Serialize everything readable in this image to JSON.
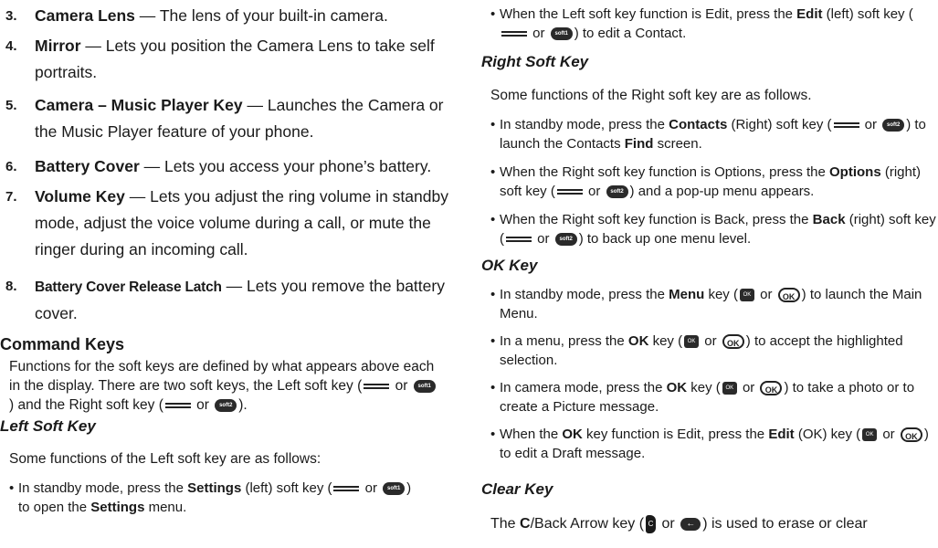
{
  "left": {
    "items": [
      {
        "num": "3.",
        "title": "Camera Lens",
        "sep": " — ",
        "text": "The lens of your built-in camera."
      },
      {
        "num": "4.",
        "title": "Mirror",
        "sep": " — ",
        "text": "Lets you position the Camera Lens to take self portraits."
      },
      {
        "num": "5.",
        "title": "Camera – Music Player Key",
        "sep": " — ",
        "text": "Launches the Camera or the Music Player feature of your phone."
      },
      {
        "num": "6.",
        "title": "Battery Cover",
        "sep": " — ",
        "text": "Lets you access your phone’s battery."
      },
      {
        "num": "7.",
        "title": "Volume Key",
        "sep": " — ",
        "text": "Lets you adjust the ring volume in standby mode, adjust the voice volume during a call, or mute the ringer during an incoming call."
      },
      {
        "num": "8.",
        "title": "Battery Cover Release Latch",
        "sep": " — ",
        "text": "Lets you remove the battery cover."
      }
    ],
    "command_keys": {
      "heading": "Command Keys",
      "p1": "Functions for the soft keys are defined by what appears above each in the display. There are two soft keys, the Left soft key (",
      "or1": " or ",
      "p2": ") and the Right soft key (",
      "or2": " or ",
      "p3": ")."
    },
    "left_soft_key": {
      "heading": "Left Soft Key",
      "intro": "Some functions of the Left soft key are as follows:",
      "b1_a": "In standby mode, press the ",
      "b1_bold": "Settings",
      "b1_b": " (left) soft key (",
      "b1_or": " or ",
      "b1_c": ") to open the ",
      "b1_bold2": "Settings",
      "b1_d": " menu."
    }
  },
  "right": {
    "edit_bullet": {
      "a": "When the Left soft key function is Edit, press the ",
      "bold": "Edit",
      "b": " (left) soft key (",
      "or": " or ",
      "c": ") to edit a Contact."
    },
    "right_soft_key": {
      "heading": "Right Soft Key",
      "intro": "Some functions of the Right soft key are as follows.",
      "b1_a": "In standby mode, press the ",
      "b1_bold": "Contacts",
      "b1_b": " (Right) soft key (",
      "b1_or": " or ",
      "b1_c": ") to launch the Contacts ",
      "b1_bold2": "Find",
      "b1_d": " screen.",
      "b2_a": "When the Right soft key function is Options, press the ",
      "b2_bold": "Options",
      "b2_b": " (right) soft key (",
      "b2_or": " or ",
      "b2_c": ") and a pop-up menu appears.",
      "b3_a": "When the Right soft key function is Back, press the ",
      "b3_bold": "Back",
      "b3_b": " (right) soft key (",
      "b3_or": " or ",
      "b3_c": ") to back up one menu level."
    },
    "ok_key": {
      "heading": "OK Key",
      "b1_a": "In standby mode, press the ",
      "b1_bold": "Menu",
      "b1_b": " key (",
      "b1_or": " or ",
      "b1_c": ") to launch the Main Menu.",
      "b2_a": "In a menu, press the ",
      "b2_bold": "OK",
      "b2_b": " key (",
      "b2_or": " or ",
      "b2_c": ") to accept the highlighted selection.",
      "b3_a": "In camera mode, press the ",
      "b3_bold": "OK",
      "b3_b": " key (",
      "b3_or": " or ",
      "b3_c": ") to take a photo or to create a Picture message.",
      "b4_a": "When the ",
      "b4_bold": "OK",
      "b4_b": " key function is Edit, press the ",
      "b4_bold2": "Edit",
      "b4_c": " (OK) key (",
      "b4_or": " or ",
      "b4_d": ") to edit a Draft message."
    },
    "clear_key": {
      "heading": "Clear Key",
      "a": "The ",
      "bold": "C",
      "b": "/Back Arrow key (",
      "or": " or ",
      "c": ") is used to erase or clear"
    }
  },
  "icons": {
    "soft_key_line": "soft-key-line-icon",
    "soft1": "soft1",
    "soft2": "soft2",
    "ok_small": "OK",
    "ok_large": "OK",
    "c_key": "C",
    "back_arrow": "←"
  }
}
